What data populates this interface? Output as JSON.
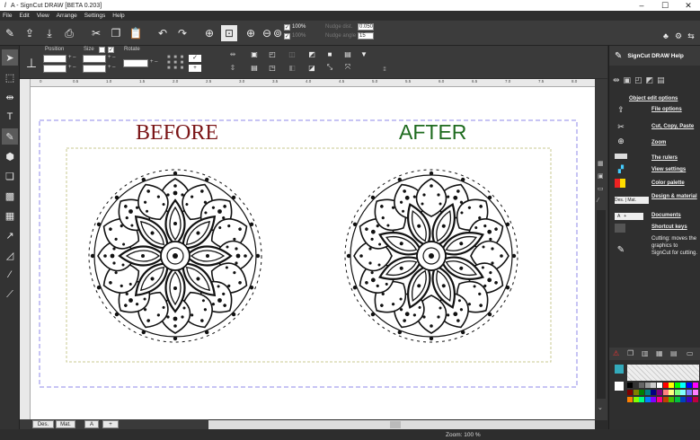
{
  "window": {
    "title": "A - SignCut DRAW  [BETA 0.203]",
    "min": "–",
    "max": "☐",
    "close": "✕"
  },
  "menu": [
    "File",
    "Edit",
    "View",
    "Arrange",
    "Settings",
    "Help"
  ],
  "toolbar": {
    "zoom_pct_a": "100%",
    "zoom_pct_b": "100%",
    "nudge_dist_label": "Nudge dist.",
    "nudge_dist_value": "0.050",
    "nudge_angle_label": "Nudge angle",
    "nudge_angle_value": "15"
  },
  "transform": {
    "position_label": "Position",
    "size_label": "Size",
    "rotate_label": "Rotate"
  },
  "ruler": {
    "top_ticks": [
      "0",
      "0.5",
      "1.0",
      "1.5",
      "2.0",
      "2.5",
      "3.0",
      "3.5",
      "4.0",
      "4.5",
      "5.0",
      "5.5",
      "6.0",
      "6.5",
      "7.0",
      "7.5",
      "8.0"
    ]
  },
  "canvas": {
    "before_label": "BEFORE",
    "after_label": "AFTER",
    "before_color": "#7a1416",
    "after_color": "#1f6b1f"
  },
  "bottom_tabs": {
    "des": "Des.",
    "mat": "Mat.",
    "a": "A",
    "plus": "+"
  },
  "status": {
    "zoom_text": "Zoom: 100 %"
  },
  "help_panel": {
    "title": "SignCut DRAW Help",
    "subtitle": "Object edit options",
    "links": [
      "File options",
      "Cut, Copy, Paste",
      "Zoom",
      "The rulers",
      "View settings",
      "Color palette",
      "Design & material",
      "Documents",
      "Shortcut keys"
    ],
    "cutting_text": "Cutting: moves the graphics to SignCut for cutting.",
    "des_label": "Des.",
    "mat_label": "Mat.",
    "a_label": "A"
  },
  "palette_colors": [
    "#000000",
    "#333333",
    "#666666",
    "#999999",
    "#cccccc",
    "#ffffff",
    "#ff0000",
    "#ffff00",
    "#00ff00",
    "#00ffff",
    "#0000ff",
    "#ff00ff",
    "#800000",
    "#808000",
    "#008000",
    "#008080",
    "#000080",
    "#800080",
    "#ff8080",
    "#ffff80",
    "#80ff80",
    "#80ffff",
    "#8080ff",
    "#ff80ff",
    "#ff8000",
    "#80ff00",
    "#00ff80",
    "#0080ff",
    "#8000ff",
    "#ff0080",
    "#c04000",
    "#40c000",
    "#00c040",
    "#0040c0",
    "#4000c0",
    "#c00040"
  ]
}
